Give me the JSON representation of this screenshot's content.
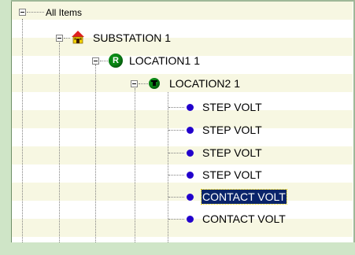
{
  "tree": {
    "root_label": "All Items",
    "substation_label": "SUBSTATION 1",
    "location1_label": "LOCATION1 1",
    "location1_badge": "R",
    "location2_label": "LOCATION2 1",
    "children": [
      {
        "label": "STEP VOLT"
      },
      {
        "label": "STEP VOLT"
      },
      {
        "label": "STEP VOLT"
      },
      {
        "label": "STEP VOLT"
      },
      {
        "label": "CONTACT VOLT",
        "selected": true
      },
      {
        "label": "CONTACT VOLT"
      }
    ]
  },
  "colors": {
    "selection_bg": "#0a246a",
    "dot": "#2200cc",
    "node_green": "#0a8a15"
  },
  "icons": {
    "substation": "house-icon",
    "location1": "circle-r-icon",
    "location2": "circle-t-icon",
    "item": "bullet-dot-icon"
  }
}
